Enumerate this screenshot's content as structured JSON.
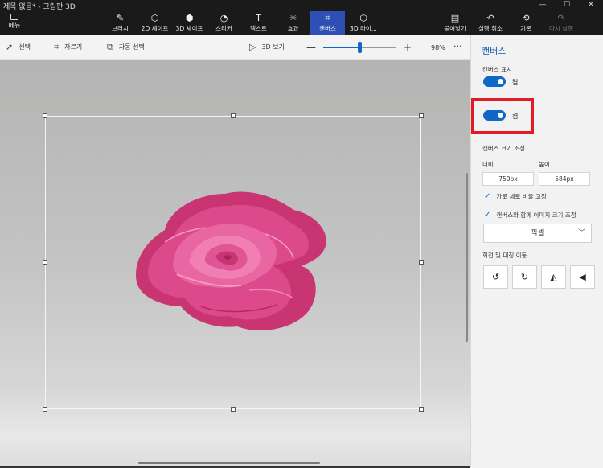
{
  "window": {
    "title": "제목 없음* - 그림판 3D",
    "controls": [
      "—",
      "☐",
      "✕"
    ]
  },
  "menu": {
    "label": "메뉴"
  },
  "ribbon": {
    "tools": [
      {
        "label": "브러시",
        "glyph": "✎",
        "icon": "brush-icon"
      },
      {
        "label": "2D 셰이프",
        "glyph": "⬡",
        "icon": "2d-shapes-icon"
      },
      {
        "label": "3D 셰이프",
        "glyph": "⬢",
        "icon": "3d-shapes-icon"
      },
      {
        "label": "스티커",
        "glyph": "◔",
        "icon": "sticker-icon"
      },
      {
        "label": "텍스트",
        "glyph": "T",
        "icon": "text-icon"
      },
      {
        "label": "효과",
        "glyph": "☼",
        "icon": "effects-icon"
      },
      {
        "label": "캔버스",
        "glyph": "⌗",
        "icon": "canvas-icon",
        "active": true
      },
      {
        "label": "3D 라이...",
        "glyph": "⬡",
        "icon": "3d-library-icon"
      }
    ],
    "right_tools": [
      {
        "label": "붙여넣기",
        "glyph": "📋",
        "icon": "paste-icon"
      },
      {
        "label": "실행 취소",
        "glyph": "↶",
        "icon": "undo-icon"
      },
      {
        "label": "기록",
        "glyph": "⟲",
        "icon": "history-icon"
      },
      {
        "label": "다시 실행",
        "glyph": "↷",
        "icon": "redo-icon",
        "disabled": true
      }
    ]
  },
  "toolbar": {
    "select_label": "선택",
    "crop_label": "자르기",
    "magic_select_label": "자동 선택",
    "view3d_label": "3D 보기",
    "zoom_minus": "—",
    "zoom_plus": "+",
    "zoom_value": "98%",
    "zoom_fraction": 0.5,
    "more": "···"
  },
  "panel": {
    "title": "캔버스",
    "show_canvas_label": "캔버스 표시",
    "toggle1_state": "켬",
    "toggle2_state": "켬",
    "resize_label": "캔버스 크기 조정",
    "width_label": "너비",
    "height_label": "높이",
    "width_value": "750px",
    "height_value": "584px",
    "lock_aspect_label": "가로 세로 비율 고정",
    "resize_image_label": "캔버스와 함께 이미지 크기 조정",
    "unit_value": "픽셀",
    "rotate_label": "회전 및 대칭 이동"
  },
  "colors": {
    "accent": "#0f68c6",
    "active_tool": "#2e4fb5",
    "highlight": "#e01c24",
    "rose": "#d63a7e"
  }
}
